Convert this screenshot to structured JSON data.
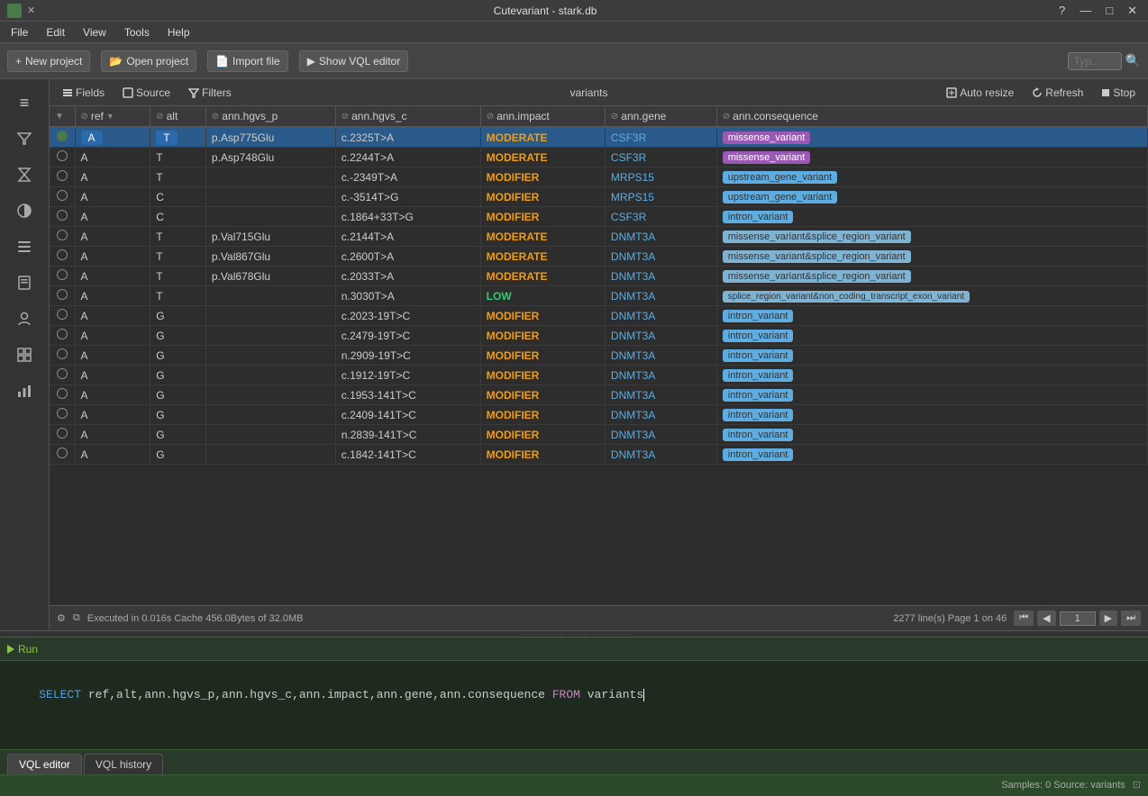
{
  "app": {
    "title": "Cutevariant - stark.db",
    "icon": "🧬"
  },
  "titlebar": {
    "help_btn": "?",
    "minimize_btn": "—",
    "maximize_btn": "□",
    "close_btn": "✕"
  },
  "menubar": {
    "items": [
      {
        "label": "File",
        "id": "file"
      },
      {
        "label": "Edit",
        "id": "edit"
      },
      {
        "label": "View",
        "id": "view"
      },
      {
        "label": "Tools",
        "id": "tools"
      },
      {
        "label": "Help",
        "id": "help"
      }
    ]
  },
  "toolbar": {
    "new_project": "New project",
    "open_project": "Open project",
    "import_file": "Import file",
    "show_vql": "Show VQL editor",
    "type_placeholder": "Typ...",
    "search_icon": "🔍"
  },
  "table_controls": {
    "fields_btn": "Fields",
    "source_btn": "Source",
    "filters_btn": "Filters",
    "variants_label": "variants",
    "auto_resize_btn": "Auto resize",
    "refresh_btn": "Refresh",
    "stop_btn": "Stop"
  },
  "columns": [
    {
      "id": "radio",
      "label": ""
    },
    {
      "id": "ref",
      "label": "ref",
      "filter": true,
      "sort": "desc"
    },
    {
      "id": "alt",
      "label": "alt",
      "filter": true
    },
    {
      "id": "ann_hgvs_p",
      "label": "ann.hgvs_p",
      "filter": true
    },
    {
      "id": "ann_hgvs_c",
      "label": "ann.hgvs_c",
      "filter": true
    },
    {
      "id": "ann_impact",
      "label": "ann.impact",
      "filter": true
    },
    {
      "id": "ann_gene",
      "label": "ann.gene",
      "filter": true
    },
    {
      "id": "ann_consequence",
      "label": "ann.consequence",
      "filter": true
    }
  ],
  "rows": [
    {
      "selected": true,
      "ref": "A",
      "alt": "T",
      "hgvs_p": "p.Asp775Glu",
      "hgvs_c": "c.2325T>A",
      "impact": "MODERATE",
      "impact_class": "moderate",
      "gene": "CSF3R",
      "consequence": "missense_variant",
      "consequence_class": "missense"
    },
    {
      "selected": false,
      "ref": "A",
      "alt": "T",
      "hgvs_p": "p.Asp748Glu",
      "hgvs_c": "c.2244T>A",
      "impact": "MODERATE",
      "impact_class": "moderate",
      "gene": "CSF3R",
      "consequence": "missense_variant",
      "consequence_class": "missense"
    },
    {
      "selected": false,
      "ref": "A",
      "alt": "T",
      "hgvs_p": "",
      "hgvs_c": "c.-2349T>A",
      "impact": "MODIFIER",
      "impact_class": "modifier",
      "gene": "MRPS15",
      "consequence": "upstream_gene_variant",
      "consequence_class": "upstream"
    },
    {
      "selected": false,
      "ref": "A",
      "alt": "C",
      "hgvs_p": "",
      "hgvs_c": "c.-3514T>G",
      "impact": "MODIFIER",
      "impact_class": "modifier",
      "gene": "MRPS15",
      "consequence": "upstream_gene_variant",
      "consequence_class": "upstream"
    },
    {
      "selected": false,
      "ref": "A",
      "alt": "C",
      "hgvs_p": "",
      "hgvs_c": "c.1864+33T>G",
      "impact": "MODIFIER",
      "impact_class": "modifier",
      "gene": "CSF3R",
      "consequence": "intron_variant",
      "consequence_class": "intron"
    },
    {
      "selected": false,
      "ref": "A",
      "alt": "T",
      "hgvs_p": "p.Val715Glu",
      "hgvs_c": "c.2144T>A",
      "impact": "MODERATE",
      "impact_class": "moderate",
      "gene": "DNMT3A",
      "consequence": "missense_variant&splice_region_variant",
      "consequence_class": "splice"
    },
    {
      "selected": false,
      "ref": "A",
      "alt": "T",
      "hgvs_p": "p.Val867Glu",
      "hgvs_c": "c.2600T>A",
      "impact": "MODERATE",
      "impact_class": "moderate",
      "gene": "DNMT3A",
      "consequence": "missense_variant&splice_region_variant",
      "consequence_class": "splice"
    },
    {
      "selected": false,
      "ref": "A",
      "alt": "T",
      "hgvs_p": "p.Val678Glu",
      "hgvs_c": "c.2033T>A",
      "impact": "MODERATE",
      "impact_class": "moderate",
      "gene": "DNMT3A",
      "consequence": "missense_variant&splice_region_variant",
      "consequence_class": "splice"
    },
    {
      "selected": false,
      "ref": "A",
      "alt": "T",
      "hgvs_p": "",
      "hgvs_c": "n.3030T>A",
      "impact": "LOW",
      "impact_class": "low",
      "gene": "DNMT3A",
      "consequence": "splice_region_variant&non_coding_transcript_exon_variant",
      "consequence_class": "splice2"
    },
    {
      "selected": false,
      "ref": "A",
      "alt": "G",
      "hgvs_p": "",
      "hgvs_c": "c.2023-19T>C",
      "impact": "MODIFIER",
      "impact_class": "modifier",
      "gene": "DNMT3A",
      "consequence": "intron_variant",
      "consequence_class": "intron"
    },
    {
      "selected": false,
      "ref": "A",
      "alt": "G",
      "hgvs_p": "",
      "hgvs_c": "c.2479-19T>C",
      "impact": "MODIFIER",
      "impact_class": "modifier",
      "gene": "DNMT3A",
      "consequence": "intron_variant",
      "consequence_class": "intron"
    },
    {
      "selected": false,
      "ref": "A",
      "alt": "G",
      "hgvs_p": "",
      "hgvs_c": "n.2909-19T>C",
      "impact": "MODIFIER",
      "impact_class": "modifier",
      "gene": "DNMT3A",
      "consequence": "intron_variant",
      "consequence_class": "intron"
    },
    {
      "selected": false,
      "ref": "A",
      "alt": "G",
      "hgvs_p": "",
      "hgvs_c": "c.1912-19T>C",
      "impact": "MODIFIER",
      "impact_class": "modifier",
      "gene": "DNMT3A",
      "consequence": "intron_variant",
      "consequence_class": "intron"
    },
    {
      "selected": false,
      "ref": "A",
      "alt": "G",
      "hgvs_p": "",
      "hgvs_c": "c.1953-141T>C",
      "impact": "MODIFIER",
      "impact_class": "modifier",
      "gene": "DNMT3A",
      "consequence": "intron_variant",
      "consequence_class": "intron"
    },
    {
      "selected": false,
      "ref": "A",
      "alt": "G",
      "hgvs_p": "",
      "hgvs_c": "c.2409-141T>C",
      "impact": "MODIFIER",
      "impact_class": "modifier",
      "gene": "DNMT3A",
      "consequence": "intron_variant",
      "consequence_class": "intron"
    },
    {
      "selected": false,
      "ref": "A",
      "alt": "G",
      "hgvs_p": "",
      "hgvs_c": "n.2839-141T>C",
      "impact": "MODIFIER",
      "impact_class": "modifier",
      "gene": "DNMT3A",
      "consequence": "intron_variant",
      "consequence_class": "intron"
    },
    {
      "selected": false,
      "ref": "A",
      "alt": "G",
      "hgvs_p": "",
      "hgvs_c": "c.1842-141T>C",
      "impact": "MODIFIER",
      "impact_class": "modifier",
      "gene": "DNMT3A",
      "consequence": "intron_variant",
      "consequence_class": "intron"
    }
  ],
  "statusbar": {
    "settings_icon": "⚙",
    "copy_icon": "⧉",
    "executed_text": "Executed in 0.016s  Cache 456.0Bytes of 32.0MB",
    "lines_text": "2277 line(s) Page 1 on 46",
    "page_first": "⏮",
    "page_prev": "◀",
    "page_num": "1",
    "page_next": "▶",
    "page_last": "⏭"
  },
  "bottom_panel": {
    "run_label": "Run",
    "sql_query": "SELECT ref,alt,ann.hgvs_p,ann.hgvs_c,ann.impact,ann.gene,ann.consequence FROM variants",
    "sql_select": "SELECT",
    "sql_from": "FROM",
    "sql_table": "variants",
    "tabs": [
      {
        "label": "VQL editor",
        "active": true
      },
      {
        "label": "VQL history",
        "active": false
      }
    ]
  },
  "footer": {
    "text": "Samples: 0  Source: variants"
  },
  "sidebar": {
    "icons": [
      {
        "name": "list-icon",
        "symbol": "≡",
        "active": false
      },
      {
        "name": "filter-icon",
        "symbol": "⊘",
        "active": false
      },
      {
        "name": "hourglass-icon",
        "symbol": "⧗",
        "active": false
      },
      {
        "name": "circle-icon",
        "symbol": "◑",
        "active": false
      },
      {
        "name": "lines-icon",
        "symbol": "☰",
        "active": false
      },
      {
        "name": "bookmark-icon",
        "symbol": "⊞",
        "active": false
      },
      {
        "name": "person-icon",
        "symbol": "👤",
        "active": false
      },
      {
        "name": "grid-icon",
        "symbol": "⊞",
        "active": false
      },
      {
        "name": "chart-icon",
        "symbol": "📊",
        "active": false
      }
    ]
  }
}
